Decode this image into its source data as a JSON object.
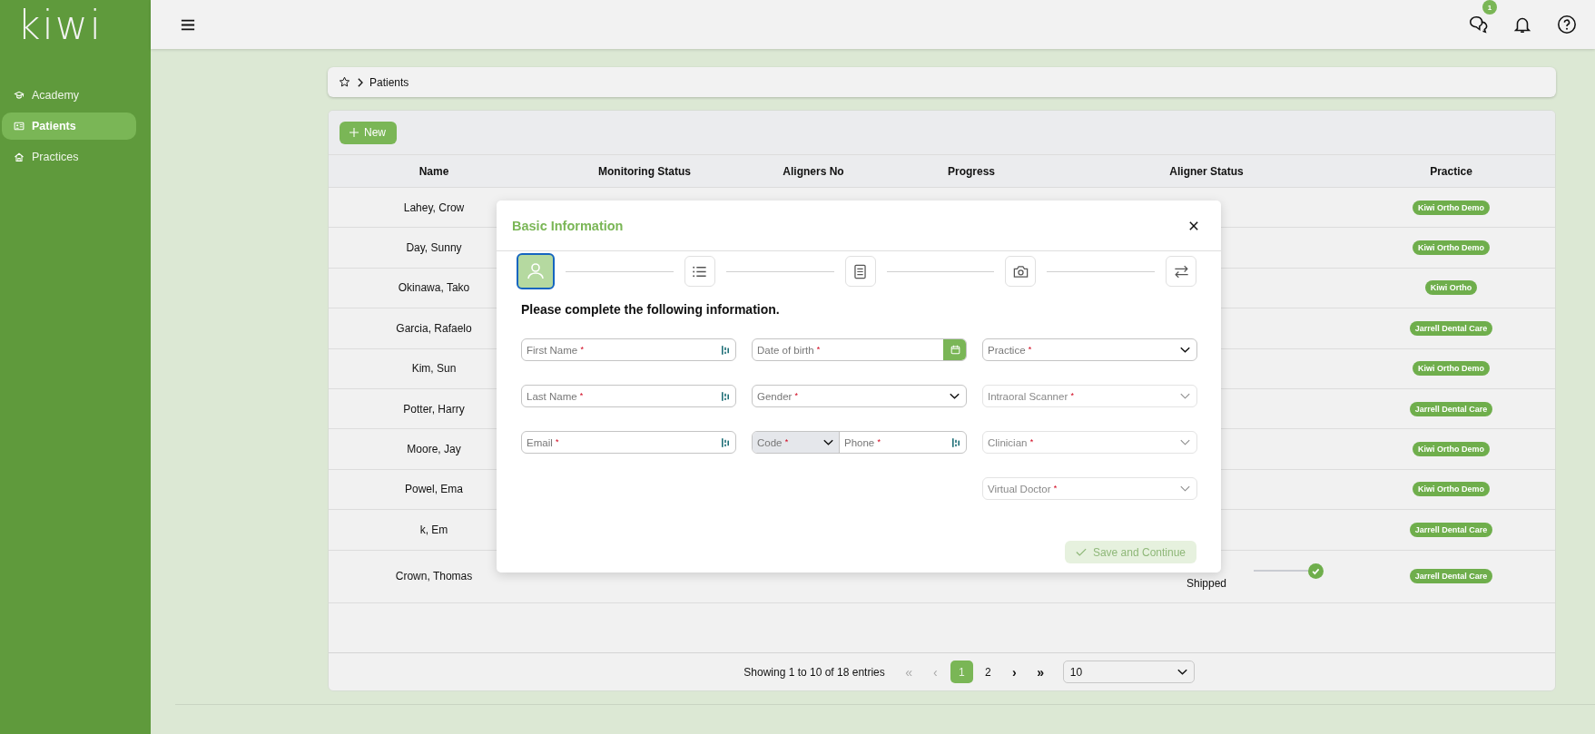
{
  "sidebar": {
    "logo": "kiwi",
    "items": [
      {
        "label": "Academy",
        "kind": "academy",
        "selected": false
      },
      {
        "label": "Patients",
        "kind": "patients",
        "selected": true
      },
      {
        "label": "Practices",
        "kind": "practices",
        "selected": false
      }
    ]
  },
  "top_bar": {
    "chat_badge": "1"
  },
  "breadcrumb": [
    "Patients"
  ],
  "table": {
    "new_button": "New",
    "columns": [
      "Name",
      "Monitoring Status",
      "Aligners No",
      "Progress",
      "Aligner Status",
      "Practice"
    ],
    "rows": [
      {
        "name": "Lahey, Crow",
        "practice": "Kiwi Ortho Demo"
      },
      {
        "name": "Day, Sunny",
        "practice": "Kiwi Ortho Demo"
      },
      {
        "name": "Okinawa, Tako",
        "practice": "Kiwi Ortho"
      },
      {
        "name": "Garcia, Rafaelo",
        "practice": "Jarrell Dental Care"
      },
      {
        "name": "Kim, Sun",
        "practice": "Kiwi Ortho Demo"
      },
      {
        "name": "Potter, Harry",
        "practice": "Jarrell Dental Care"
      },
      {
        "name": "Moore, Jay",
        "practice": "Kiwi Ortho Demo"
      },
      {
        "name": "Powel, Ema",
        "practice": "Kiwi Ortho Demo"
      },
      {
        "name": "k, Em",
        "practice": "Jarrell Dental Care"
      },
      {
        "name": "Crown, Thomas",
        "practice": "Jarrell Dental Care",
        "aligner_status": "Shipped"
      }
    ]
  },
  "pagination": {
    "summary": "Showing 1 to 10 of 18 entries",
    "before": [
      {
        "label": "«",
        "disabled": true
      },
      {
        "label": "‹",
        "disabled": true
      }
    ],
    "pages": [
      {
        "label": "1",
        "selected": true
      },
      {
        "label": "2",
        "selected": false
      }
    ],
    "after": [
      {
        "label": "›",
        "disabled": false
      },
      {
        "label": "»",
        "disabled": false
      }
    ],
    "page_size": "10"
  },
  "modal": {
    "title": "Basic Information",
    "steps": [
      {
        "kind": "person",
        "selected": true
      },
      {
        "kind": "list",
        "selected": false
      },
      {
        "kind": "document",
        "selected": false
      },
      {
        "kind": "camera",
        "selected": false
      },
      {
        "kind": "transfer",
        "selected": false
      }
    ],
    "heading": "Please complete the following information.",
    "columns": [
      [
        {
          "kind": "text",
          "placeholder": "First Name",
          "mark": "*"
        },
        {
          "kind": "text",
          "placeholder": "Last Name",
          "mark": "*"
        },
        {
          "kind": "text",
          "placeholder": "Email",
          "mark": "*"
        }
      ],
      [
        {
          "kind": "date",
          "placeholder": "Date of birth",
          "mark": "*"
        },
        {
          "kind": "select",
          "placeholder": "Gender",
          "mark": "*",
          "disabled": false
        },
        {
          "kind": "phone",
          "code_placeholder": "Code",
          "code_mark": "*",
          "placeholder": "Phone",
          "mark": "*"
        }
      ],
      [
        {
          "kind": "select",
          "placeholder": "Practice",
          "mark": "*",
          "disabled": false
        },
        {
          "kind": "select",
          "placeholder": "Intraoral Scanner",
          "mark": "*",
          "disabled": true
        },
        {
          "kind": "select",
          "placeholder": "Clinician",
          "mark": "*",
          "disabled": true
        },
        {
          "kind": "select",
          "placeholder": "Virtual Doctor",
          "mark": "*",
          "disabled": true
        }
      ]
    ],
    "save_button": {
      "label": "Save and Continue",
      "disabled": true
    }
  }
}
